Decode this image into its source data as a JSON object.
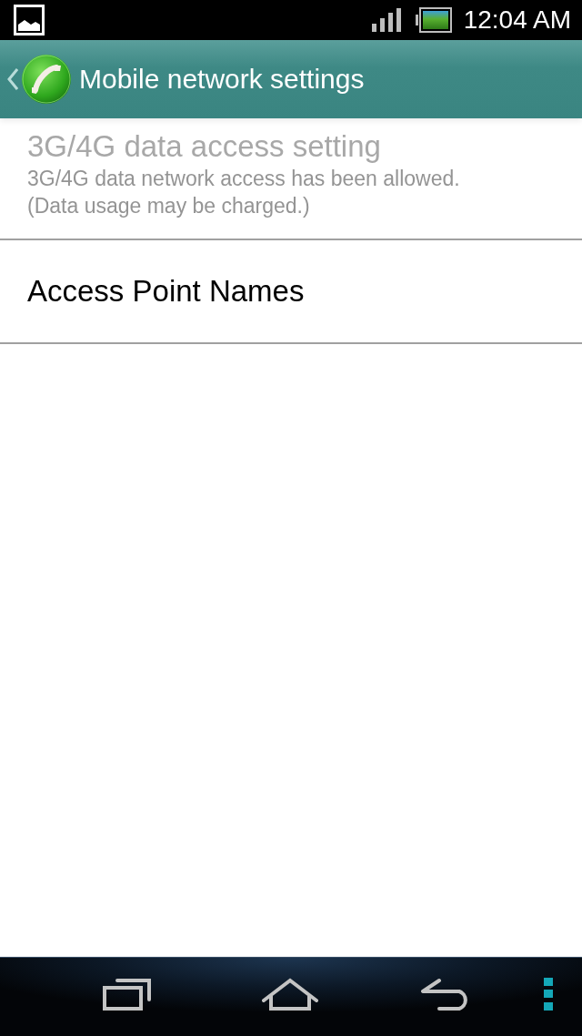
{
  "status_bar": {
    "time": "12:04 AM"
  },
  "action_bar": {
    "title": "Mobile network settings"
  },
  "settings": [
    {
      "title": "3G/4G data access setting",
      "summary": "3G/4G data network access has been allowed.\n(Data usage may be charged.)",
      "disabled": true
    },
    {
      "title": "Access Point Names",
      "disabled": false
    }
  ]
}
